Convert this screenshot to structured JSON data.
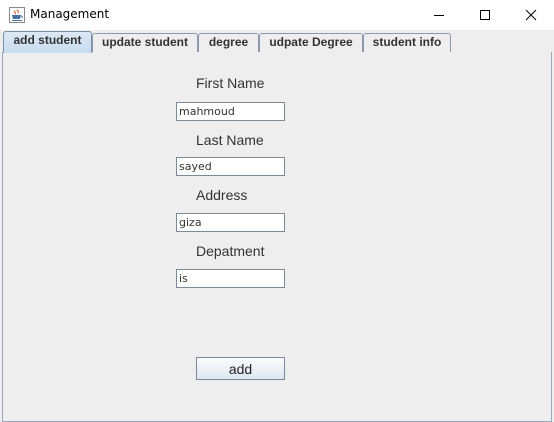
{
  "window": {
    "title": "Management"
  },
  "tabs": [
    {
      "label": "add student",
      "selected": true
    },
    {
      "label": "update student",
      "selected": false
    },
    {
      "label": "degree",
      "selected": false
    },
    {
      "label": "udpate Degree",
      "selected": false
    },
    {
      "label": "student info",
      "selected": false
    }
  ],
  "form": {
    "first_name": {
      "label": "First Name",
      "value": "mahmoud"
    },
    "last_name": {
      "label": "Last Name",
      "value": "sayed"
    },
    "address": {
      "label": "Address",
      "value": "giza"
    },
    "department": {
      "label": "Depatment",
      "value": "is"
    }
  },
  "add_button": {
    "label": "add"
  },
  "icons": {
    "app": "java-cup-icon",
    "minimize": "minimize-icon",
    "maximize": "maximize-icon",
    "close": "close-icon"
  },
  "colors": {
    "selected_tab": "#c8dcf0",
    "window_bg": "#eeeeee",
    "tab_border": "#8a9bb0"
  }
}
